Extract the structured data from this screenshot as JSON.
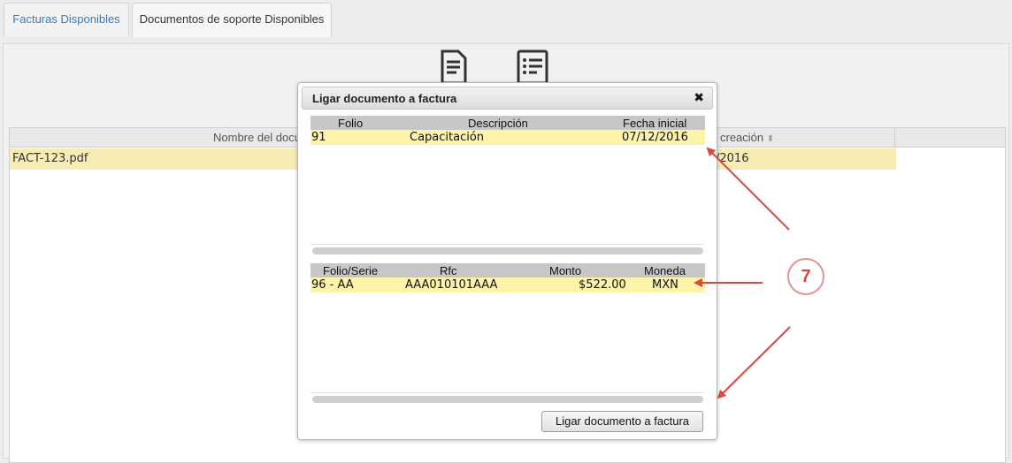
{
  "tabs": {
    "facturas": "Facturas Disponibles",
    "documentos": "Documentos de soporte Disponibles"
  },
  "toolbar": {
    "icons": [
      "edit-document-icon",
      "remove-list-icon"
    ]
  },
  "grid": {
    "col_name_header": "Nombre del docu",
    "col_date_header": "creación",
    "row": {
      "name": "FACT-123.pdf",
      "date": "/2016"
    }
  },
  "modal": {
    "title": "Ligar documento a factura",
    "close": "✖",
    "documents": {
      "headers": {
        "folio": "Folio",
        "descripcion": "Descripción",
        "fecha": "Fecha inicial"
      },
      "row": {
        "folio": "91",
        "descripcion": "Capacitación",
        "fecha": "07/12/2016"
      }
    },
    "invoices": {
      "headers": {
        "folio_serie": "Folio/Serie",
        "rfc": "Rfc",
        "monto": "Monto",
        "moneda": "Moneda"
      },
      "row": {
        "folio_serie": "96 - AA",
        "rfc": "AAA010101AAA",
        "monto": "$522.00",
        "moneda": "MXN"
      }
    },
    "link_button": "Ligar documento a factura"
  },
  "annotation": {
    "step_number": "7",
    "color": "#e0453f"
  }
}
